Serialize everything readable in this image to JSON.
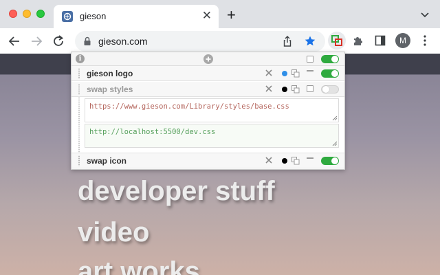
{
  "browser": {
    "tab": {
      "title": "gieson"
    },
    "omnibox": {
      "url": "gieson.com"
    },
    "profile": {
      "initial": "M"
    }
  },
  "page": {
    "nav_links": [
      "developer stuff",
      "video",
      "art works"
    ]
  },
  "popup": {
    "rules": [
      {
        "name": "gieson logo",
        "enabled": true,
        "dot_color": "#2f8fe8"
      },
      {
        "name": "swap styles",
        "enabled": false,
        "dot_color": "#000000",
        "from_url": "https://www.gieson.com/Library/styles/base.css",
        "to_url": "http://localhost:5500/dev.css"
      },
      {
        "name": "swap icon",
        "enabled": true,
        "dot_color": "#000000"
      }
    ],
    "header_toggle_enabled": true
  },
  "colors": {
    "toggle_on": "#2faa3f",
    "star_blue": "#1a73e8",
    "from_url_text": "#b4655c",
    "to_url_text": "#56a05c"
  },
  "icons": [
    "lock-icon",
    "share-icon",
    "star-icon",
    "puzzle-icon",
    "side-panel-icon",
    "kebab-menu-icon",
    "info-icon",
    "add-icon",
    "delete-icon",
    "copy-icon",
    "dash-icon",
    "grip-icon"
  ]
}
